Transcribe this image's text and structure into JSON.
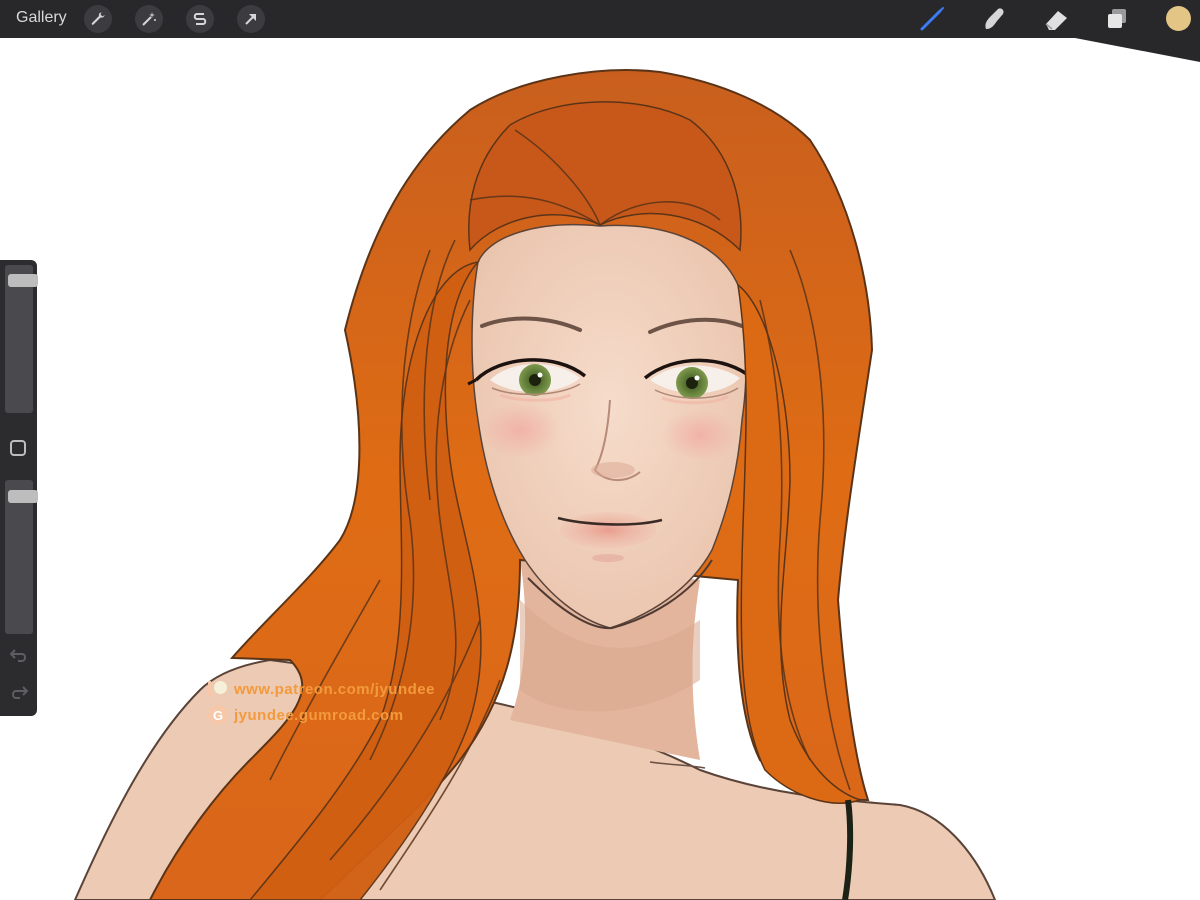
{
  "toolbar": {
    "gallery_label": "Gallery",
    "actions_icon": "wrench-icon",
    "adjustments_icon": "magic-wand-icon",
    "selection_icon": "selection-s-icon",
    "transform_icon": "transform-arrow-icon",
    "brush_icon": "brush-icon",
    "smudge_icon": "smudge-finger-icon",
    "eraser_icon": "eraser-icon",
    "layers_icon": "layers-icon",
    "current_color": "#e3c586",
    "active_tool": "brush"
  },
  "sidebar": {
    "brush_size_level": 0.93,
    "opacity_level": 0.93,
    "modify_icon": "square-icon",
    "undo_icon": "undo-icon",
    "redo_icon": "redo-icon"
  },
  "watermark": {
    "patreon_text": "www.patreon.com/jyundee",
    "gumroad_text": "jyundee.gumroad.com",
    "gumroad_letter": "G",
    "text_color": "#f39a3c",
    "icon_color": "#f6c7a8"
  },
  "colors": {
    "toolbar_bg": "#28282b",
    "canvas_bg": "#ffffff",
    "accent_blue": "#3b7bf5",
    "hair": "#d9661a",
    "skin": "#f1d5c2",
    "iris": "#6a8a40"
  }
}
